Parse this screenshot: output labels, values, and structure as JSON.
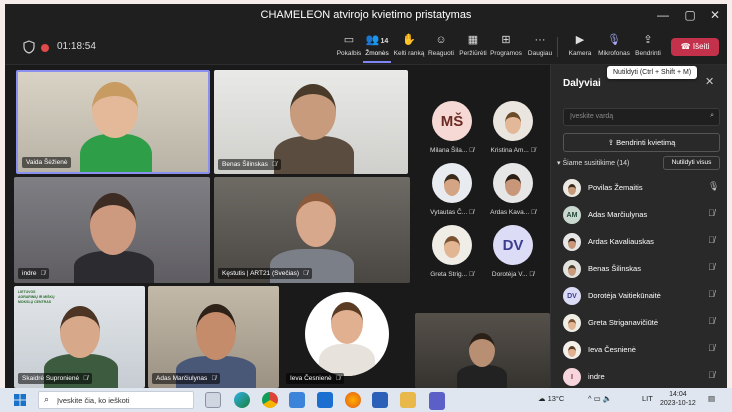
{
  "window": {
    "title": "CHAMELEON atvirojo kvietimo pristatymas",
    "minimize": "—",
    "maximize": "▢",
    "close": "✕"
  },
  "toolbar": {
    "timer": "01:18:54",
    "buttons": [
      {
        "label": "Pokalbis",
        "icon": "chat-icon"
      },
      {
        "label": "Žmonės",
        "icon": "people-icon",
        "badge": "14"
      },
      {
        "label": "Kelti ranką",
        "icon": "hand-icon"
      },
      {
        "label": "Reaguoti",
        "icon": "smile-icon"
      },
      {
        "label": "Peržiūrėti",
        "icon": "view-icon"
      },
      {
        "label": "Programos",
        "icon": "apps-icon"
      },
      {
        "label": "Daugiau",
        "icon": "more-icon"
      },
      {
        "label": "Kamera",
        "icon": "camera-icon"
      },
      {
        "label": "Mikrofonas",
        "icon": "microphone-icon"
      },
      {
        "label": "Bendrinti",
        "icon": "share-icon"
      }
    ],
    "leave": "Išeiti",
    "tooltip": "Nutildyti (Ctrl + Shift + M)"
  },
  "tiles": [
    {
      "name": "Vaida Šėžienė"
    },
    {
      "name": "Benas Šilinskas"
    },
    {
      "name": "indre"
    },
    {
      "name": "Kęstutis | ART21 (Svečias)"
    },
    {
      "name": "Skaidrė Supronienė"
    },
    {
      "name": "Adas Marčiulynas"
    },
    {
      "name": "Ieva Česnienė"
    },
    {
      "name": ""
    }
  ],
  "logo_text": [
    "LIETUVOS",
    "AGRARINIŲ IR MIŠKŲ",
    "MOKSLŲ CENTRAS"
  ],
  "small_tiles": [
    {
      "initials": "MŠ",
      "name": "Milana Šila..."
    },
    {
      "initials": "",
      "name": "Kristina Am..."
    },
    {
      "initials": "",
      "name": "Vytautas Č..."
    },
    {
      "initials": "",
      "name": "Ardas Kava..."
    },
    {
      "initials": "",
      "name": "Greta Strig..."
    },
    {
      "initials": "DV",
      "name": "Dorotėja V..."
    }
  ],
  "panel": {
    "title": "Dalyviai",
    "search_placeholder": "Įveskite vardą",
    "share": "Bendrinti kvietimą",
    "section": "Šiame susitikime (14)",
    "mute_all": "Nutildyti visus",
    "participants": [
      {
        "name": "Povilas Žemaitis",
        "initials": "",
        "status": "microphone-icon"
      },
      {
        "name": "Adas Marčiulynas",
        "initials": "AM",
        "status": "muted-icon"
      },
      {
        "name": "Ardas Kavaliauskas",
        "initials": "",
        "status": "muted-icon"
      },
      {
        "name": "Benas Šilinskas",
        "initials": "",
        "status": "muted-icon"
      },
      {
        "name": "Dorotėja Vaitiekūnaitė",
        "initials": "DV",
        "status": "muted-icon"
      },
      {
        "name": "Greta Striganavičiūtė",
        "initials": "",
        "status": "muted-icon"
      },
      {
        "name": "Ieva Česnienė",
        "initials": "",
        "status": "muted-icon"
      },
      {
        "name": "indre",
        "initials": "I",
        "status": "muted-icon"
      }
    ]
  },
  "taskbar": {
    "search": "Įveskite čia, ko ieškoti",
    "temperature": "13°C",
    "language": "LIT",
    "time": "14:04",
    "date": "2023-10-12"
  },
  "colors": {
    "accent": "#7f85f5",
    "leave": "#c4314b",
    "active_border": "#8a8ff0"
  }
}
